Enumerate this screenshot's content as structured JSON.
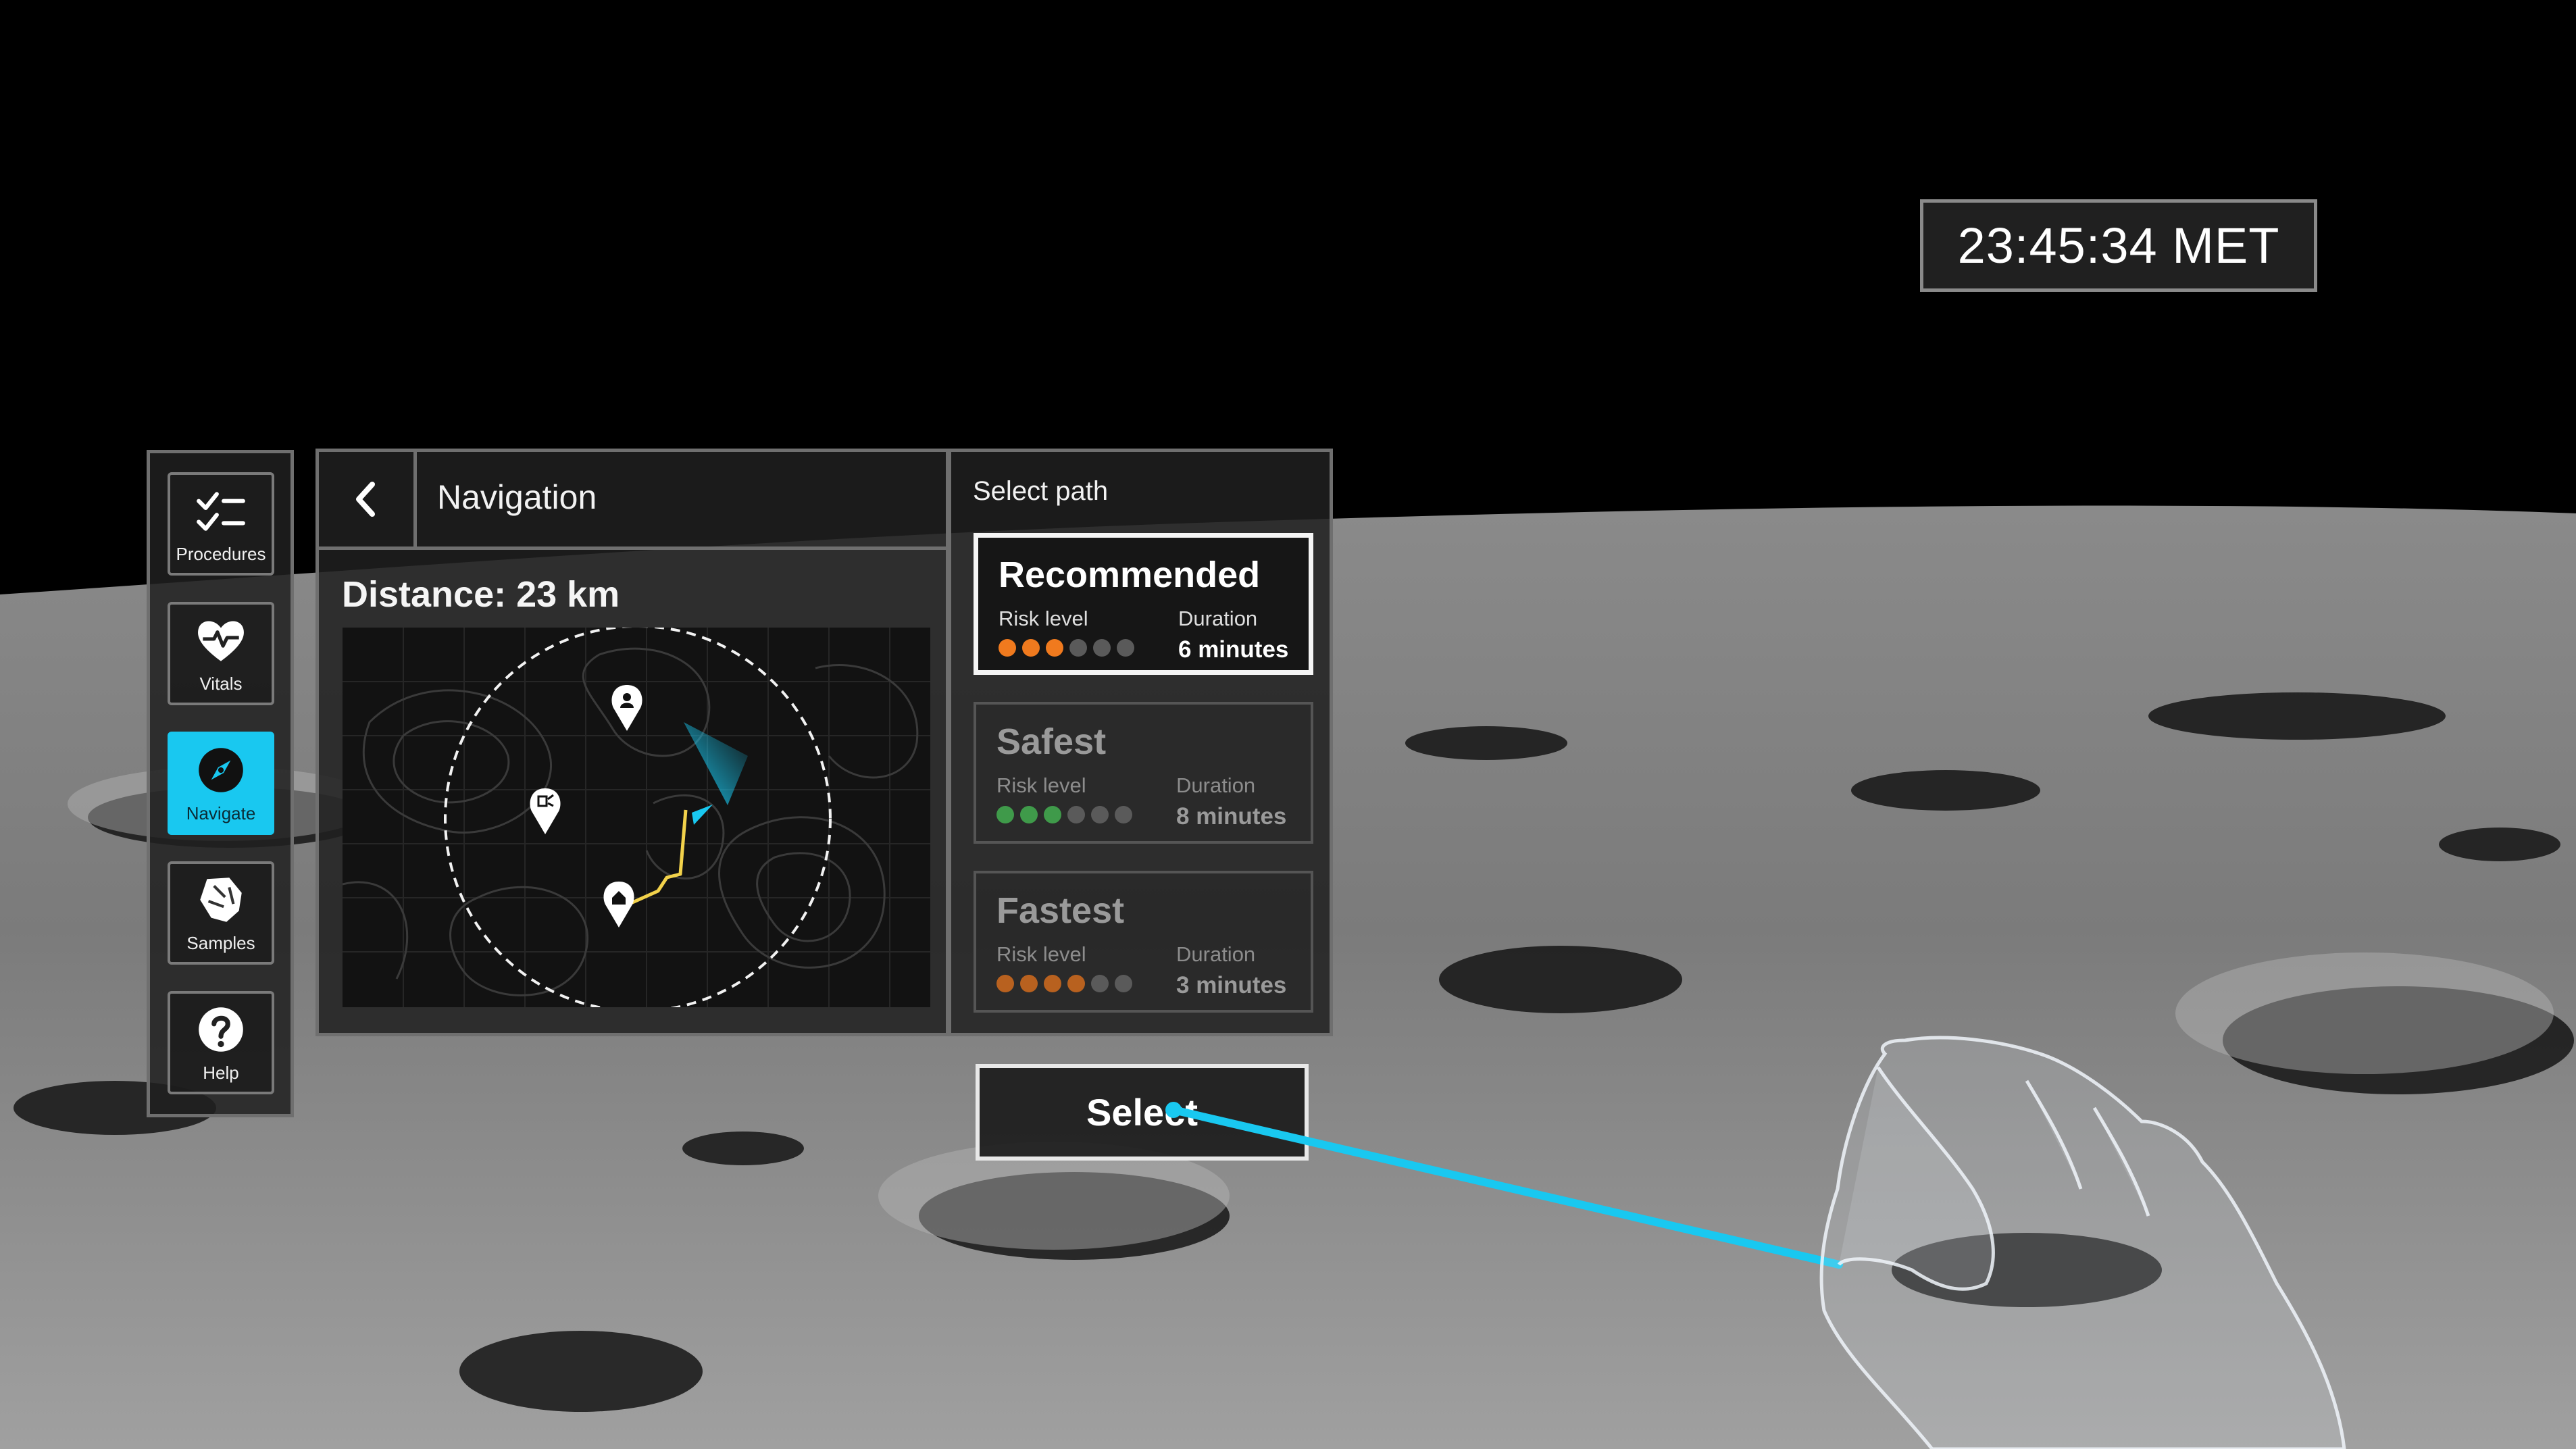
{
  "met": {
    "clock": "23:45:34 MET"
  },
  "sidebar": {
    "items": [
      {
        "label": "Procedures",
        "icon": "checklist-icon",
        "active": false
      },
      {
        "label": "Vitals",
        "icon": "heart-pulse-icon",
        "active": false
      },
      {
        "label": "Navigate",
        "icon": "compass-icon",
        "active": true
      },
      {
        "label": "Samples",
        "icon": "rock-sample-icon",
        "active": false
      },
      {
        "label": "Help",
        "icon": "help-icon",
        "active": false
      }
    ]
  },
  "navigation": {
    "title": "Navigation",
    "distance": "Distance: 23 km",
    "map": {
      "markers": [
        "person-pin-icon",
        "equipment-pin-icon",
        "home-pin-icon",
        "user-heading-icon"
      ]
    }
  },
  "paths": {
    "title": "Select path",
    "options": [
      {
        "name": "Recommended",
        "risk_label": "Risk level",
        "duration_label": "Duration",
        "duration": "6 minutes",
        "risk_filled": 3,
        "risk_total": 6,
        "risk_color": "#f07a1e",
        "selected": true
      },
      {
        "name": "Safest",
        "risk_label": "Risk level",
        "duration_label": "Duration",
        "duration": "8 minutes",
        "risk_filled": 3,
        "risk_total": 6,
        "risk_color": "#3f9a4a",
        "selected": false
      },
      {
        "name": "Fastest",
        "risk_label": "Risk level",
        "duration_label": "Duration",
        "duration": "3 minutes",
        "risk_filled": 4,
        "risk_total": 6,
        "risk_color": "#b8611f",
        "selected": false
      }
    ]
  },
  "select_button": {
    "label": "Select"
  },
  "colors": {
    "accent": "#19c8f0",
    "route": "#f2d24b",
    "risk_off": "#5a5a5a"
  }
}
